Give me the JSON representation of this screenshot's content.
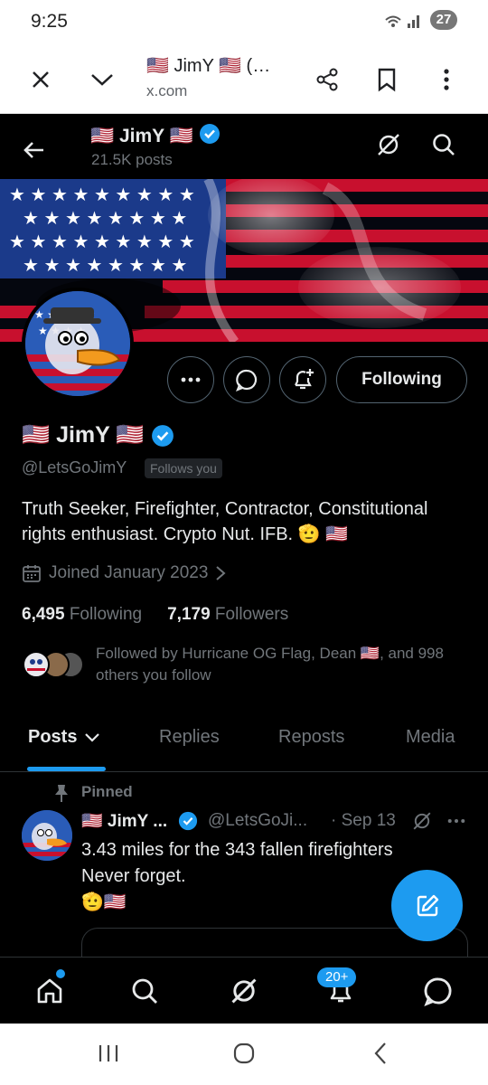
{
  "status_bar": {
    "time": "9:25",
    "signal": "☷ .∣∥",
    "battery": "27"
  },
  "browser": {
    "title": "🇺🇸 JimY 🇺🇸 (…",
    "url": "x.com"
  },
  "header": {
    "name": "🇺🇸 JimY 🇺🇸",
    "posts": "21.5K posts"
  },
  "profile": {
    "display_name": "🇺🇸 JimY 🇺🇸",
    "handle": "@LetsGoJimY",
    "follows_you": "Follows you",
    "bio": "Truth Seeker, Firefighter, Contractor, Constitutional rights enthusiast. Crypto Nut. IFB. 🫡 🇺🇸",
    "joined": "Joined January 2023",
    "following_count": "6,495",
    "following_label": "Following",
    "followers_count": "7,179",
    "followers_label": "Followers",
    "followed_by": "Followed by Hurricane OG Flag, Dean 🇺🇸, and 998 others you follow",
    "following_button": "Following"
  },
  "tabs": [
    {
      "label": "Posts"
    },
    {
      "label": "Replies"
    },
    {
      "label": "Reposts"
    },
    {
      "label": "Media"
    }
  ],
  "pinned_post": {
    "pinned_label": "Pinned",
    "name": "🇺🇸 JimY ...",
    "handle": "@LetsGoJi...",
    "date": "· Sep 13",
    "text_line1": "3.43 miles for the 343 fallen firefighters",
    "text_line2": "Never forget.",
    "text_line3": "🫡🇺🇸"
  },
  "bottom_nav": {
    "notifications_badge": "20+"
  },
  "colors": {
    "accent": "#1d9bf0",
    "muted": "#71767b",
    "text": "#e7e9ea",
    "border": "#2f3336",
    "background": "#000000"
  }
}
